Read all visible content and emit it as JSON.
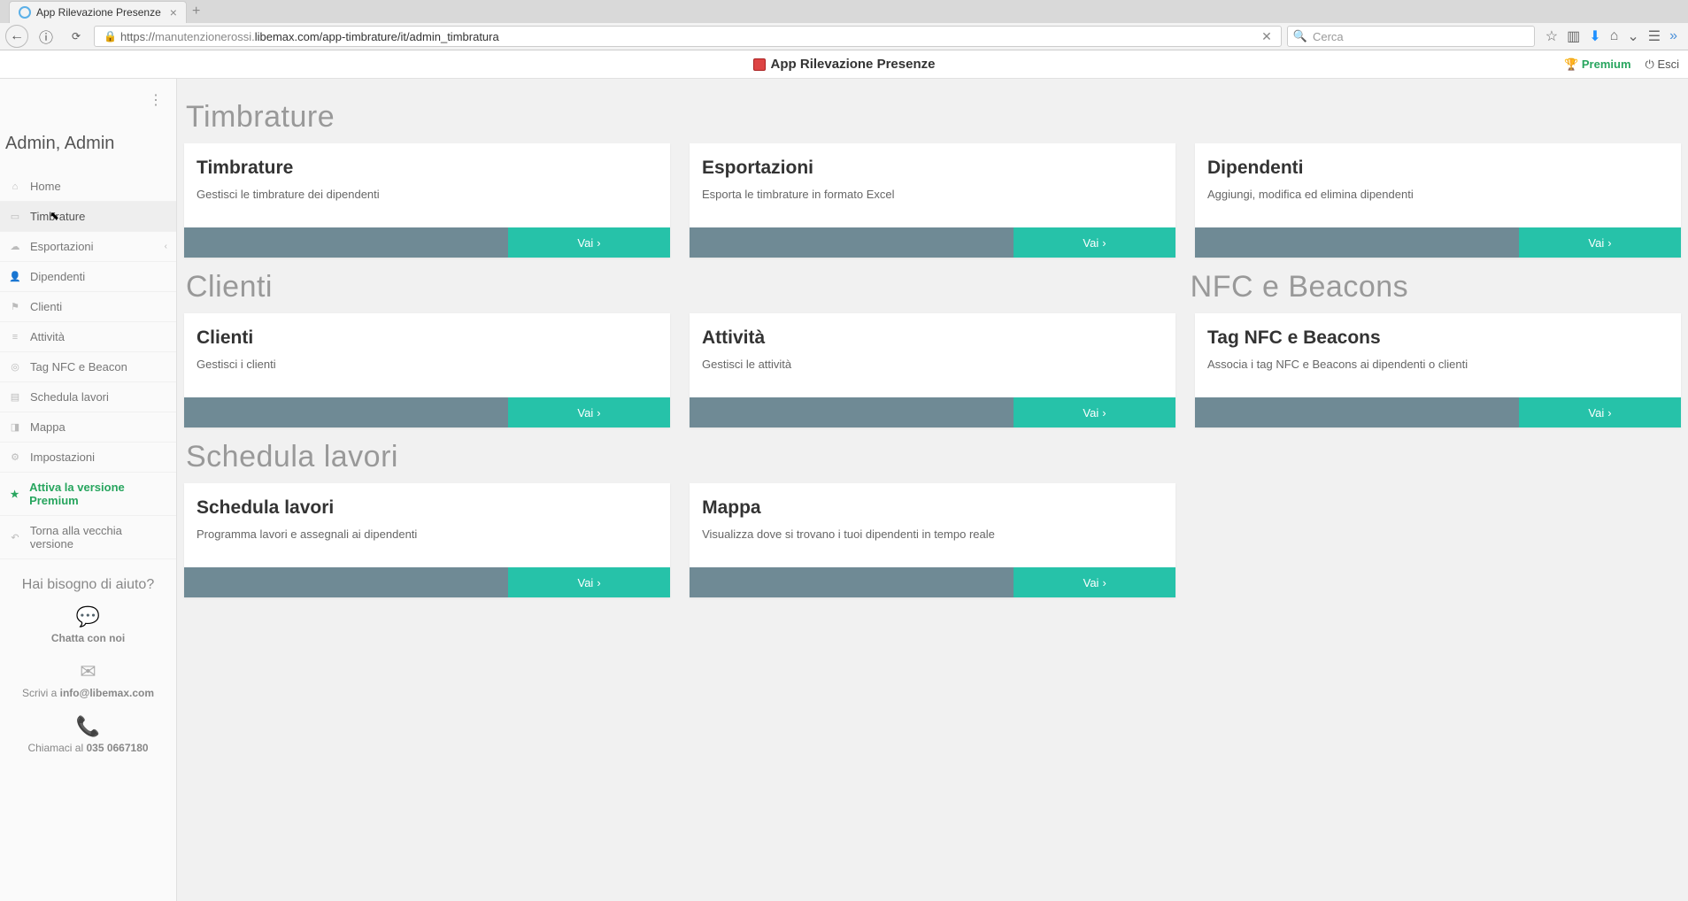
{
  "browser": {
    "tab_title": "App Rilevazione Presenze",
    "url": "https://manutenzionerossi.libemax.com/app-timbrature/it/admin_timbratura",
    "url_host_prefix": "https://",
    "url_host": "manutenzionerossi.",
    "url_rest": "libemax.com/app-timbrature/it/admin_timbratura",
    "search_placeholder": "Cerca"
  },
  "header": {
    "title": "App Rilevazione Presenze",
    "premium": "Premium",
    "logout": "Esci"
  },
  "sidebar": {
    "user": "Admin, Admin",
    "items": [
      {
        "label": "Home",
        "icon": "⌂"
      },
      {
        "label": "Timbrature",
        "icon": "▭",
        "active": true
      },
      {
        "label": "Esportazioni",
        "icon": "☁",
        "expandable": true
      },
      {
        "label": "Dipendenti",
        "icon": "👤"
      },
      {
        "label": "Clienti",
        "icon": "⚑"
      },
      {
        "label": "Attività",
        "icon": "≡"
      },
      {
        "label": "Tag NFC e Beacon",
        "icon": "◎"
      },
      {
        "label": "Schedula lavori",
        "icon": "▤"
      },
      {
        "label": "Mappa",
        "icon": "◨"
      },
      {
        "label": "Impostazioni",
        "icon": "⚙"
      },
      {
        "label": "Attiva la versione Premium",
        "icon": "★",
        "premium": true
      },
      {
        "label": "Torna alla vecchia versione",
        "icon": "↶"
      }
    ],
    "help": {
      "question": "Hai bisogno di aiuto?",
      "chat": "Chatta con noi",
      "write_prefix": "Scrivi a ",
      "email": "info@libemax.com",
      "call_prefix": "Chiamaci al ",
      "phone": "035 0667180"
    }
  },
  "sections": [
    {
      "title": "Timbrature",
      "cards": [
        {
          "title": "Timbrature",
          "desc": "Gestisci le timbrature dei dipendenti",
          "go": "Vai"
        },
        {
          "title": "Esportazioni",
          "desc": "Esporta le timbrature in formato Excel",
          "go": "Vai"
        },
        {
          "title": "Dipendenti",
          "desc": "Aggiungi, modifica ed elimina dipendenti",
          "go": "Vai"
        }
      ]
    }
  ],
  "row2": {
    "left_title": "Clienti",
    "right_title": "NFC e Beacons",
    "cards": [
      {
        "title": "Clienti",
        "desc": "Gestisci i clienti",
        "go": "Vai"
      },
      {
        "title": "Attività",
        "desc": "Gestisci le attività",
        "go": "Vai"
      },
      {
        "title": "Tag NFC e Beacons",
        "desc": "Associa i tag NFC e Beacons ai dipendenti o clienti",
        "go": "Vai"
      }
    ]
  },
  "row3": {
    "title": "Schedula lavori",
    "cards": [
      {
        "title": "Schedula lavori",
        "desc": "Programma lavori e assegnali ai dipendenti",
        "go": "Vai"
      },
      {
        "title": "Mappa",
        "desc": "Visualizza dove si trovano i tuoi dipendenti in tempo reale",
        "go": "Vai"
      }
    ]
  }
}
